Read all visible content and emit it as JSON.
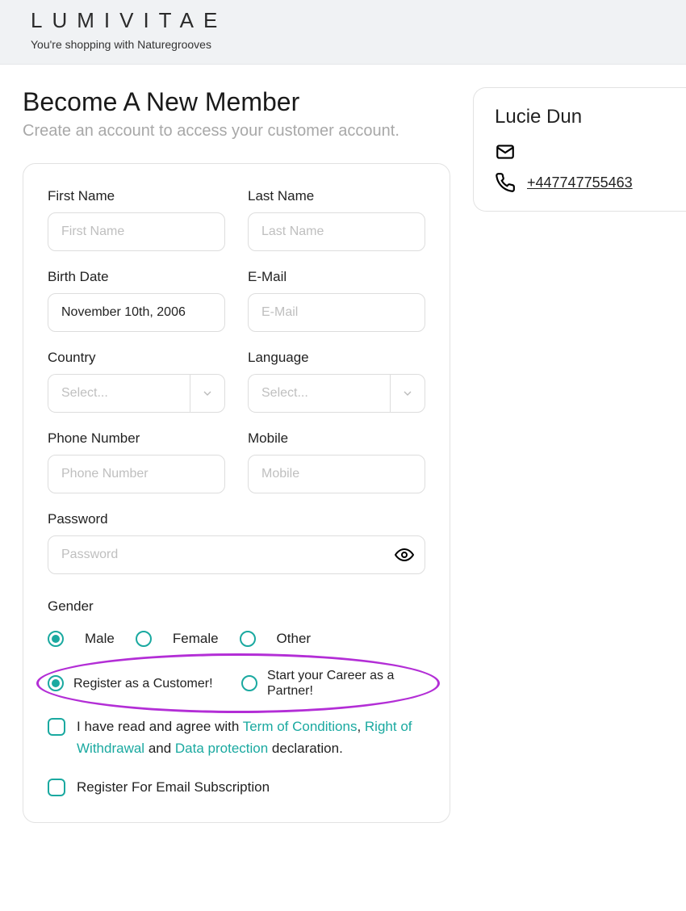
{
  "header": {
    "brand": "LUMIVITAE",
    "shop_with": "You're shopping with Naturegrooves"
  },
  "page": {
    "title": "Become A New Member",
    "subtitle": "Create an account to access your customer account."
  },
  "form": {
    "first_name": {
      "label": "First Name",
      "placeholder": "First Name",
      "value": ""
    },
    "last_name": {
      "label": "Last Name",
      "placeholder": "Last Name",
      "value": ""
    },
    "birth_date": {
      "label": "Birth Date",
      "value": "November 10th, 2006"
    },
    "email": {
      "label": "E-Mail",
      "placeholder": "E-Mail",
      "value": ""
    },
    "country": {
      "label": "Country",
      "placeholder": "Select..."
    },
    "language": {
      "label": "Language",
      "placeholder": "Select..."
    },
    "phone": {
      "label": "Phone Number",
      "placeholder": "Phone Number",
      "value": ""
    },
    "mobile": {
      "label": "Mobile",
      "placeholder": "Mobile",
      "value": ""
    },
    "password": {
      "label": "Password",
      "placeholder": "Password",
      "value": ""
    },
    "gender": {
      "label": "Gender",
      "options": [
        {
          "label": "Male",
          "selected": true
        },
        {
          "label": "Female",
          "selected": false
        },
        {
          "label": "Other",
          "selected": false
        }
      ]
    },
    "account_type": {
      "customer": {
        "label": "Register as a Customer!",
        "selected": true
      },
      "partner": {
        "label": "Start your Career as a Partner!",
        "selected": false
      }
    },
    "terms": {
      "pre": "I have read and agree with ",
      "link1": "Term of Conditions",
      "sep1": ", ",
      "link2": "Right of Withdrawal",
      "mid": " and ",
      "link3": "Data protection",
      "post": " declaration."
    },
    "email_sub": {
      "label": "Register For Email Subscription"
    }
  },
  "contact": {
    "name": "Lucie Dun",
    "phone": "+447747755463"
  }
}
